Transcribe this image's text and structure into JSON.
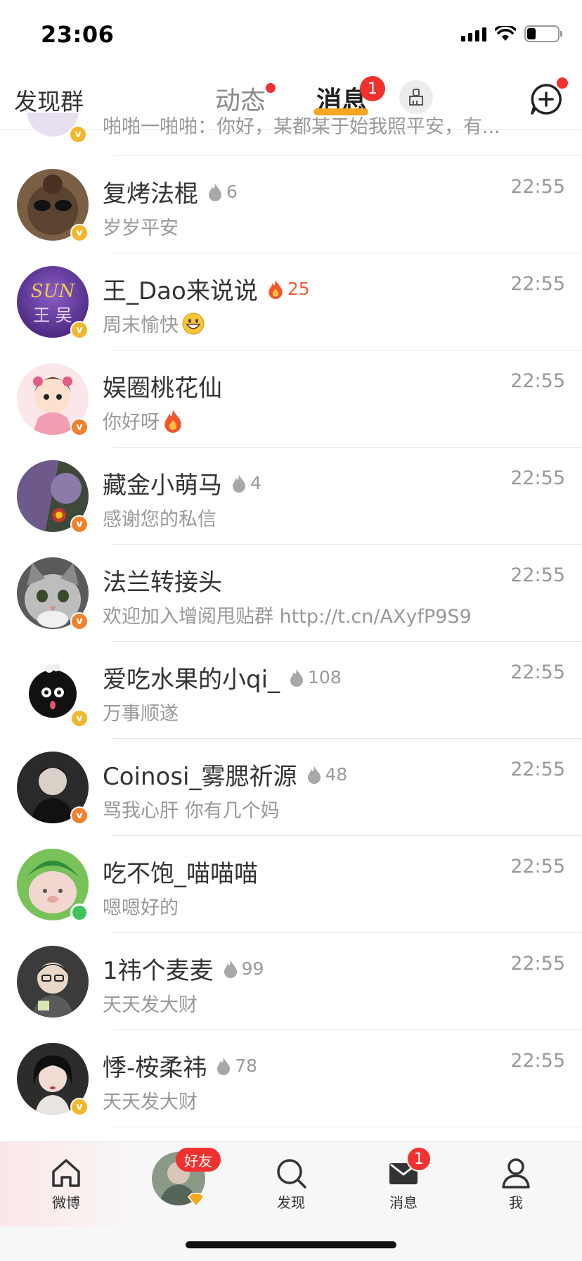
{
  "status_bar": {
    "time": "23:06"
  },
  "top_nav": {
    "left_label": "发现群",
    "tabs": [
      {
        "label": "动态",
        "has_dot": true
      },
      {
        "label": "消息",
        "active": true,
        "badge": "1"
      }
    ]
  },
  "partial_row": {
    "message": "啪啪一啪啪：你好，某都某于始我照平安，有..."
  },
  "conversations": [
    {
      "name": "复烤法棍",
      "flame": "6",
      "flame_hot": false,
      "message": "岁岁平安",
      "time": "22:55",
      "badge": "v-yellow"
    },
    {
      "name": "王_Dao来说说",
      "flame": "25",
      "flame_hot": true,
      "message": "周末愉快",
      "emoji": "grin",
      "time": "22:55",
      "badge": "v-yellow"
    },
    {
      "name": "娱圈桃花仙",
      "flame": "",
      "message": "你好呀",
      "emoji": "fire",
      "time": "22:55",
      "badge": "v-orange"
    },
    {
      "name": "藏金小萌马",
      "flame": "4",
      "flame_hot": false,
      "message": "感谢您的私信",
      "time": "22:55",
      "badge": "v-orange"
    },
    {
      "name": "法兰转接头",
      "flame": "",
      "message": "欢迎加入增阅甩贴群 http://t.cn/AXyfP9S9",
      "time": "22:55",
      "badge": "v-orange"
    },
    {
      "name": "爱吃水果的小qi_",
      "flame": "108",
      "flame_hot": false,
      "message": "万事顺遂",
      "time": "22:55",
      "badge": "v-yellow"
    },
    {
      "name": "Coinosi_雾腮祈源",
      "flame": "48",
      "flame_hot": false,
      "message": "骂我心肝 你有几个妈",
      "time": "22:55",
      "badge": "v-orange"
    },
    {
      "name": "吃不饱_喵喵喵",
      "flame": "",
      "message": "嗯嗯好的",
      "time": "22:55",
      "badge": "online"
    },
    {
      "name": "1祎个麦麦",
      "flame": "99",
      "flame_hot": false,
      "message": "天天发大财",
      "time": "22:55",
      "badge": "none"
    },
    {
      "name": "悸-桉柔祎",
      "flame": "78",
      "flame_hot": false,
      "message": "天天发大财",
      "time": "22:55",
      "badge": "v-yellow"
    }
  ],
  "tabbar": {
    "items": [
      {
        "label": "微博",
        "icon": "home-icon"
      },
      {
        "label": "好友",
        "icon": "friends-avatar"
      },
      {
        "label": "发现",
        "icon": "search-icon"
      },
      {
        "label": "消息",
        "icon": "mail-icon",
        "badge": "1"
      },
      {
        "label": "我",
        "icon": "profile-icon"
      }
    ]
  },
  "colors": {
    "accent": "#f5a623",
    "badge_red": "#f0312f",
    "verified_yellow": "#f2b72c",
    "verified_orange": "#f0822e"
  }
}
